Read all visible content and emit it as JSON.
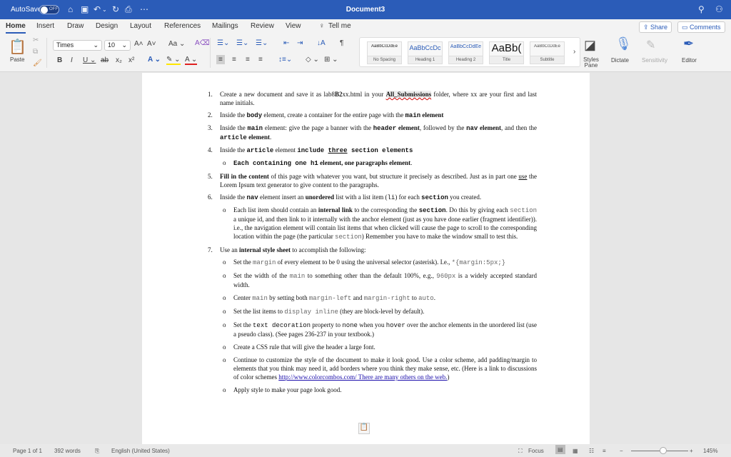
{
  "titlebar": {
    "autosave": "AutoSave",
    "toggle": "OFF",
    "title": "Document3"
  },
  "tabs": [
    "Home",
    "Insert",
    "Draw",
    "Design",
    "Layout",
    "References",
    "Mailings",
    "Review",
    "View",
    "Tell me"
  ],
  "share": "Share",
  "comments": "Comments",
  "ribbon": {
    "paste": "Paste",
    "font": "Times",
    "size": "10",
    "styles": [
      {
        "preview": "AaBbCcDdEe",
        "name": "No Spacing"
      },
      {
        "preview": "AaBbCcDc",
        "name": "Heading 1"
      },
      {
        "preview": "AaBbCcDdEe",
        "name": "Heading 2"
      },
      {
        "preview": "AaBb(",
        "name": "Title"
      },
      {
        "preview": "AaBbCcDdEe",
        "name": "Subtitle"
      }
    ],
    "styles_pane": "Styles Pane",
    "dictate": "Dictate",
    "sensitivity": "Sensitivity",
    "editor": "Editor"
  },
  "document": {
    "items": [
      {
        "num": "1.",
        "runs": [
          [
            "Create a new document and save it as lab8",
            ""
          ],
          [
            "B2",
            "b"
          ],
          [
            "xx.html in your ",
            ""
          ],
          [
            "All_Submissions",
            "hl sq"
          ],
          [
            " folder, where xx are your first and last name initials.",
            ""
          ]
        ]
      },
      {
        "num": "2.",
        "runs": [
          [
            "Inside the ",
            ""
          ],
          [
            "body",
            "mb"
          ],
          [
            " element, create a container for the entire page with the ",
            ""
          ],
          [
            "main",
            "mb"
          ],
          [
            " element",
            "b"
          ]
        ]
      },
      {
        "num": "3.",
        "runs": [
          [
            "Inside the ",
            ""
          ],
          [
            "main",
            "mb"
          ],
          [
            " element: give the page a banner with the ",
            ""
          ],
          [
            "header",
            "mb"
          ],
          [
            " element",
            "b"
          ],
          [
            ", followed by the ",
            ""
          ],
          [
            "nav",
            "mb"
          ],
          [
            " element",
            "b"
          ],
          [
            ", and then the ",
            ""
          ],
          [
            "article",
            "mb"
          ],
          [
            " element",
            "b"
          ],
          [
            ".",
            ""
          ]
        ]
      },
      {
        "num": "4.",
        "runs": [
          [
            "Inside the ",
            ""
          ],
          [
            "article",
            "mb"
          ],
          [
            " element ",
            ""
          ],
          [
            "include ",
            "mb"
          ],
          [
            "three",
            "mb u"
          ],
          [
            " section elements",
            "mb"
          ]
        ],
        "subs": [
          {
            "runs": [
              [
                "Each containing one ",
                "mb"
              ],
              [
                "h1",
                "mb"
              ],
              [
                " element, one paragraphs element",
                "b"
              ],
              [
                ".",
                ""
              ]
            ]
          }
        ]
      },
      {
        "num": "5.",
        "runs": [
          [
            "Fill in the content",
            "b"
          ],
          [
            " of this page with whatever you want, but structure it precisely as described. Just as in part one ",
            ""
          ],
          [
            "use",
            "u"
          ],
          [
            " the Lorem Ipsum text generator to give content to the paragraphs.",
            ""
          ]
        ]
      },
      {
        "num": "6.",
        "runs": [
          [
            "Inside the ",
            ""
          ],
          [
            "nav",
            "mb"
          ],
          [
            " element insert an ",
            ""
          ],
          [
            "unordered",
            "b"
          ],
          [
            " list with a list item (",
            ""
          ],
          [
            "li",
            "m"
          ],
          [
            ") for each ",
            ""
          ],
          [
            "section",
            "mb"
          ],
          [
            " you created.",
            ""
          ]
        ],
        "subs": [
          {
            "runs": [
              [
                "Each list item should contain an ",
                ""
              ],
              [
                "internal link",
                "b"
              ],
              [
                " to the corresponding the ",
                ""
              ],
              [
                "section",
                "mb"
              ],
              [
                ". Do this by giving each ",
                ""
              ],
              [
                "section",
                "ml"
              ],
              [
                " a unique id, and then link to it internally with the anchor element (just as you have done earlier (fragment identifier)). i.e., the navigation element will contain list items that when clicked will cause the page to scroll to the corresponding location within the page (the particular ",
                ""
              ],
              [
                "section",
                "ml"
              ],
              [
                ") Remember you have to make the window small to test this.",
                ""
              ]
            ]
          }
        ]
      },
      {
        "num": "7.",
        "runs": [
          [
            "Use an ",
            ""
          ],
          [
            "internal style sheet",
            "b"
          ],
          [
            " to accomplish the following:",
            ""
          ]
        ],
        "subs": [
          {
            "runs": [
              [
                "Set the ",
                ""
              ],
              [
                "margin",
                "ml"
              ],
              [
                " of every element to be 0 using the universal selector (asterisk). I.e., ",
                ""
              ],
              [
                "*{margin:5px;}",
                "ml"
              ]
            ]
          },
          {
            "runs": [
              [
                "Set the width of the ",
                ""
              ],
              [
                "main",
                "ml"
              ],
              [
                " to something other than the default 100%, e.g., ",
                ""
              ],
              [
                "960px",
                "ml"
              ],
              [
                " is a widely accepted standard width.",
                ""
              ]
            ]
          },
          {
            "runs": [
              [
                "Center ",
                ""
              ],
              [
                "main",
                "ml"
              ],
              [
                " by setting both ",
                ""
              ],
              [
                "margin-left",
                "ml"
              ],
              [
                " and ",
                ""
              ],
              [
                "margin-right",
                "ml"
              ],
              [
                " to ",
                ""
              ],
              [
                "auto",
                "ml"
              ],
              [
                ".",
                ""
              ]
            ]
          },
          {
            "runs": [
              [
                "Set the list items to ",
                ""
              ],
              [
                "display inline",
                "ml"
              ],
              [
                " (they are block-level by default).",
                ""
              ]
            ]
          },
          {
            "runs": [
              [
                "Set the ",
                ""
              ],
              [
                "text decoration",
                "m"
              ],
              [
                " property to ",
                ""
              ],
              [
                "none",
                "m"
              ],
              [
                " when you ",
                ""
              ],
              [
                "hover",
                "m"
              ],
              [
                " over the anchor elements in the unordered list (use a pseudo class). (See pages 236-237 in your textbook.)",
                ""
              ]
            ]
          },
          {
            "runs": [
              [
                "Create a CSS rule that will give the header a large font.",
                ""
              ]
            ]
          },
          {
            "runs": [
              [
                "Continue to customize the style of the document to make it look good. Use a color scheme, add padding/margin to elements that you think may need it, add borders where you think they make sense, etc. (Here is a link to discussions of color schemes ",
                ""
              ],
              [
                "http://www.colorcombos.com/ There are many others on the web.",
                "lk"
              ],
              [
                ")",
                ""
              ]
            ]
          },
          {
            "runs": [
              [
                "Apply style to make your page look good.",
                ""
              ]
            ]
          }
        ]
      }
    ]
  },
  "status": {
    "page": "Page 1 of 1",
    "words": "392 words",
    "language": "English (United States)",
    "focus": "Focus",
    "zoom": "145%"
  }
}
